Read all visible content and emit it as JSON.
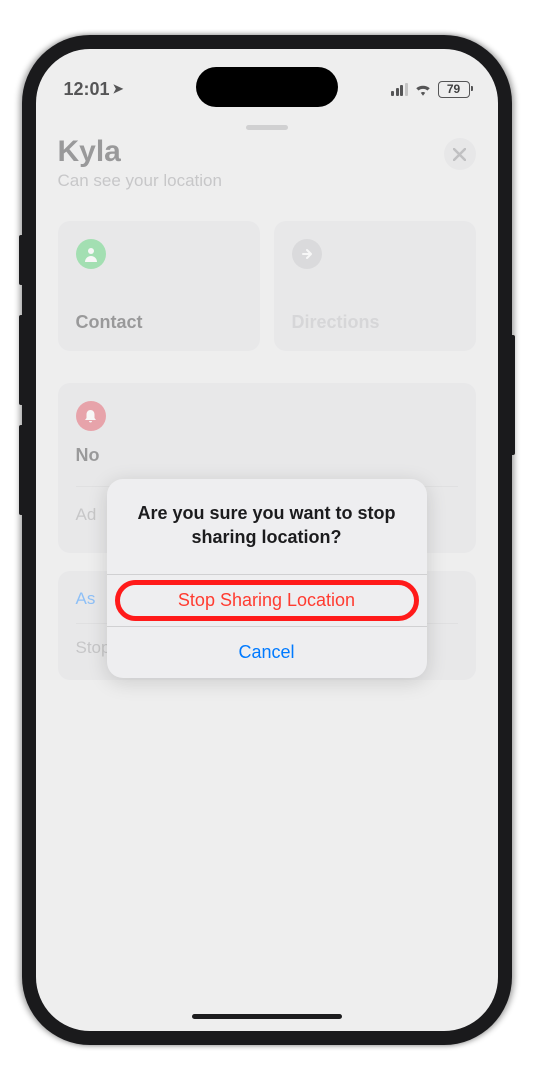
{
  "status": {
    "time": "12:01",
    "battery": "79"
  },
  "header": {
    "name": "Kyla",
    "subtitle": "Can see your location"
  },
  "actions": {
    "contact": "Contact",
    "directions": "Directions"
  },
  "notifications": {
    "title_truncated": "No",
    "add": "Ad"
  },
  "links": {
    "ask_truncated": "As",
    "stop_sharing": "Stop Sharing My Location"
  },
  "alert": {
    "message": "Are you sure you want to stop sharing location?",
    "stop": "Stop Sharing Location",
    "cancel": "Cancel"
  }
}
